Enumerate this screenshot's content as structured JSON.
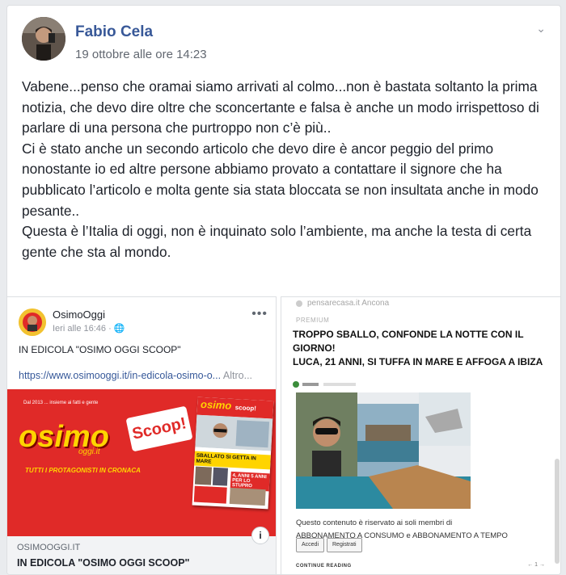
{
  "post": {
    "author": "Fabio Cela",
    "timestamp": "19 ottobre alle ore 14:23",
    "body": "Vabene...penso che oramai siamo arrivati al colmo...non è bastata soltanto la prima notizia, che devo dire oltre che sconcertante e falsa è anche un modo irrispettoso di parlare di una persona che purtroppo non c’è più..\nCi è stato anche un secondo articolo che devo dire è ancor peggio del primo nonostante io ed altre persone abbiamo provato a contattare il signore che ha pubblicato l’articolo e molta gente sia stata bloccata se non insultata anche in modo pesante..\nQuesta è l’Italia di oggi, non è inquinato solo l’ambiente, ma anche la testa di certa gente che sta al mondo.",
    "menu_icon": "chevron-down-icon"
  },
  "shared_left": {
    "page_name": "OsimoOggi",
    "time": "Ieri alle 16:46 · ",
    "caption": "IN EDICOLA \"OSIMO OGGI SCOOP\"",
    "link": "https://www.osimooggi.it/in-edicola-osimo-o...",
    "link_more": " Altro...",
    "banner_logo": "osimo",
    "banner_logo_sub": "oggi.it",
    "banner_scoop": "Scoop!",
    "banner_tagline": "TUTTI I PROTAGONISTI IN CRONACA",
    "banner_small": "Dal 2013 ... insieme ai fatti e gente",
    "magazine_logo": "osimo",
    "magazine_scoop": "scoop!",
    "magazine_headline": "SBALLATO SI GETTA IN MARE",
    "magazine_sub": "4, ANNI 5 ANNI PER LO STUPRO",
    "domain": "OSIMOOGGI.IT",
    "link_title": "IN EDICOLA \"OSIMO OGGI SCOOP\"",
    "info_label": "i"
  },
  "shared_right": {
    "site": "pensarecasa.it Ancona",
    "premium": "PREMIUM",
    "headline": "TROPPO SBALLO, CONFONDE LA NOTTE CON IL GIORNO!\nLUCA, 21 ANNI, SI TUFFA IN MARE E AFFOGA A IBIZA",
    "restricted": "Questo contenuto è riservato ai soli membri di\nABBONAMENTO A CONSUMO e ABBONAMENTO A TEMPO",
    "btn_login": "Accedi",
    "btn_register": "Registrati",
    "continue": "CONTINUE READING",
    "pager": "← 1 →"
  },
  "colors": {
    "link": "#385898",
    "banner_red": "#e02a28",
    "logo_yellow": "#ffd400"
  }
}
